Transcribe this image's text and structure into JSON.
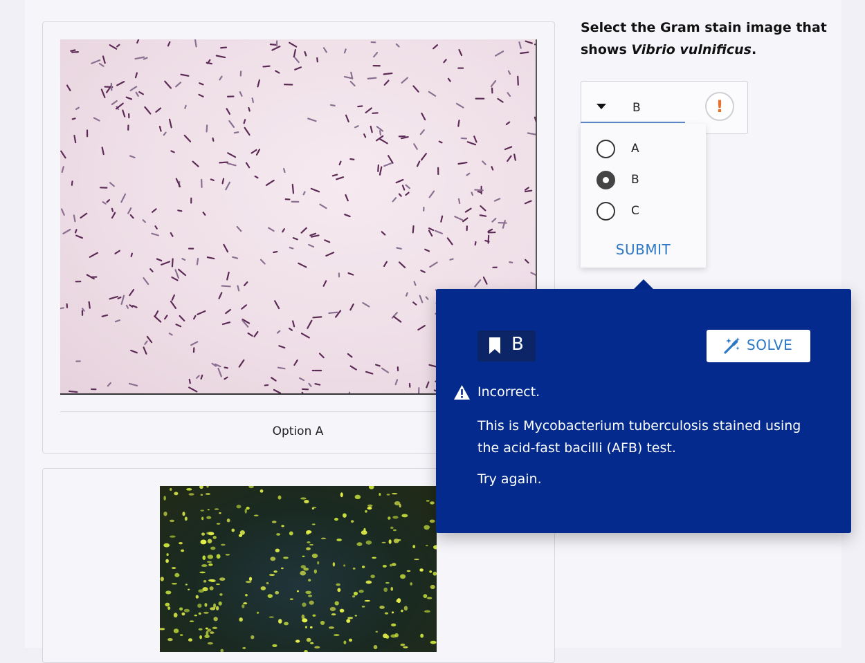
{
  "question": {
    "prefix": "Select the Gram stain image that shows ",
    "organism": "Vibrio vulnificus",
    "suffix": "."
  },
  "options": [
    {
      "caption": "Option A",
      "image": "gram-stain-pink-rods"
    },
    {
      "caption": "",
      "image": "fluorescent-stain-yellow-green"
    }
  ],
  "select": {
    "value": "B",
    "status_icon": "!",
    "choices": [
      "A",
      "B",
      "C"
    ],
    "selected": "B",
    "submit_label": "SUBMIT"
  },
  "feedback": {
    "answer": "B",
    "solve_label": "SOLVE",
    "title": "Incorrect.",
    "message": "This is Mycobacterium tuberculosis stained using the acid-fast bacilli (AFB) test.",
    "retry": "Try again."
  },
  "colors": {
    "popover_bg": "#032a8c",
    "accent_blue": "#2d78c4",
    "warning_orange": "#e8712e"
  }
}
